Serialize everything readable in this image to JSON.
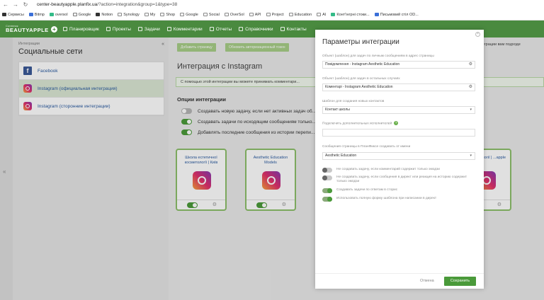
{
  "browser": {
    "url_host": "center-beautyapple.planfix.ua",
    "url_path": "/?action=integration&group=1&type=38",
    "bookmarks": [
      "Сервисы",
      "Bitmp",
      "oversol",
      "Google",
      "Notion",
      "Synology",
      "My",
      "Shop",
      "Google",
      "Social",
      "OverSol",
      "API",
      "Project",
      "Education",
      "AI",
      "Конт'інгрні стоки...",
      "Письмовий стіл OD..."
    ]
  },
  "appnav": {
    "logo_small": "Сотенник",
    "logo_big": "BEAUTYAPPLE",
    "items": [
      "Планировщик",
      "Проекты",
      "Задачи",
      "Комментарии",
      "Отчеты",
      "Справочники",
      "Контакты"
    ]
  },
  "sidebar": {
    "crumb": "Интеграции",
    "title": "Социальные сети",
    "collapse": "«",
    "items": [
      {
        "label": "Facebook"
      },
      {
        "label": "Instagram (официальная интеграция)"
      },
      {
        "label": "Instagram (сторонние интеграции)"
      }
    ]
  },
  "main": {
    "btn_add": "Добавить страницу",
    "btn_update": "Обновить авторизационный токен",
    "title": "Интеграция с Instagram",
    "info": "С помощью этой интеграции вы можете принимать комментари...",
    "info_right": "интеграции вам подходе",
    "options_title": "Опции интеграции",
    "options": [
      "Создавать новую задачу, если нет активных задач об...",
      "Создавать задачи по исходящим сообщениям только...",
      "Добавлять последние сообщения из истории перепи..."
    ],
    "cards": [
      {
        "text": "Школа естетичної косметології | Київ"
      },
      {
        "text": "Aesthetic Education Models"
      },
      {
        "text": "...осметології | ...apple"
      }
    ]
  },
  "modal": {
    "title": "Параметры интеграции",
    "close": "×",
    "label1": "Объект (шаблон) для задач по личным сообщениям в адрес страницы",
    "value1": "Повідомлення - Instagram Aesthetic Education",
    "label2": "Объект (шаблон) для задач в остальных случаях",
    "value2": "Коментарі - Instagram Aesthetic Education",
    "label3": "Шаблон для создания новых контактов",
    "value3": "Контакт школы",
    "label4": "Подключить дополнительных исполнителей",
    "help": "?",
    "label5": "Сообщения страницы в ПланФиксе создавать от имени",
    "value5": "Aesthetic Education",
    "options": [
      "Не создавать задачу, если комментарий содержит только эмодзи",
      "Не создавать задачу, если сообщения в директ или реакция на историю содержит только эмодзи",
      "Создавать задачи по ответам в сторис",
      "Использовать полную форму шаблона при написании в директ"
    ],
    "cancel": "Отмена",
    "save": "Сохранить"
  }
}
